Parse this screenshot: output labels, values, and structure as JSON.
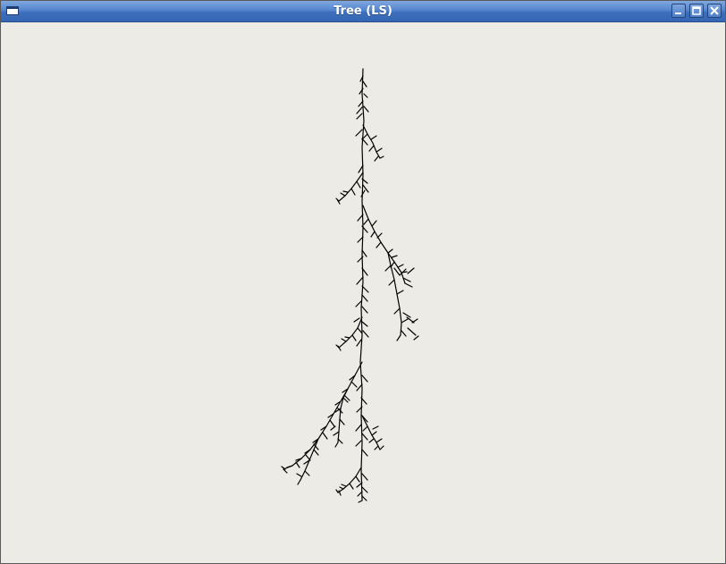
{
  "window": {
    "title": "Tree (LS)",
    "accent": "#3e6fbd",
    "background": "#edebe5"
  },
  "titlebar": {
    "menu_icon": "window-menu-icon",
    "minimize_icon": "minimize-icon",
    "maximize_icon": "maximize-icon",
    "close_icon": "close-icon"
  },
  "canvas": {
    "content": "l-system-tree",
    "stroke_color": "#000000"
  }
}
